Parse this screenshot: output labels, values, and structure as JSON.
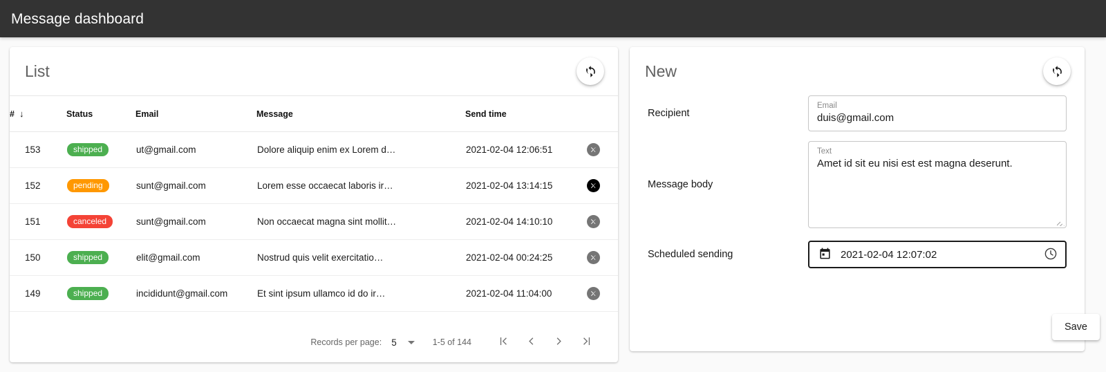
{
  "appbar": {
    "title": "Message dashboard",
    "bg": "#333333",
    "fg": "#ffffff"
  },
  "list_card": {
    "title": "List",
    "refresh_icon": "refresh-icon",
    "columns": [
      {
        "key": "num",
        "label": "#",
        "sort": "↓"
      },
      {
        "key": "status",
        "label": "Status"
      },
      {
        "key": "email",
        "label": "Email"
      },
      {
        "key": "msg",
        "label": "Message"
      },
      {
        "key": "time",
        "label": "Send time"
      }
    ],
    "rows": [
      {
        "num": "153",
        "status": "shipped",
        "status_class": "shipped",
        "email": "ut@gmail.com",
        "msg": "Dolore aliquip enim ex Lorem d…",
        "time": "2021-02-04 12:06:51",
        "delete_hover": false
      },
      {
        "num": "152",
        "status": "pending",
        "status_class": "pending",
        "email": "sunt@gmail.com",
        "msg": "Lorem esse occaecat laboris ir…",
        "time": "2021-02-04 13:14:15",
        "delete_hover": true
      },
      {
        "num": "151",
        "status": "canceled",
        "status_class": "canceled",
        "email": "sunt@gmail.com",
        "msg": "Non occaecat magna sint mollit…",
        "time": "2021-02-04 14:10:10",
        "delete_hover": false
      },
      {
        "num": "150",
        "status": "shipped",
        "status_class": "shipped",
        "email": "elit@gmail.com",
        "msg": "Nostrud quis velit exercitatio…",
        "time": "2021-02-04 00:24:25",
        "delete_hover": false
      },
      {
        "num": "149",
        "status": "shipped",
        "status_class": "shipped",
        "email": "incididunt@gmail.com",
        "msg": "Et sint ipsum ullamco id do ir…",
        "time": "2021-02-04 11:04:00",
        "delete_hover": false
      }
    ],
    "status_colors": {
      "shipped": "#4caf50",
      "pending": "#ff9800",
      "canceled": "#f44336"
    },
    "paginator": {
      "label": "Records per page:",
      "page_size": "5",
      "range": "1-5 of 144",
      "first_icon": "first-page-icon",
      "prev_icon": "previous-page-icon",
      "next_icon": "next-page-icon",
      "last_icon": "last-page-icon"
    }
  },
  "new_card": {
    "title": "New",
    "refresh_icon": "refresh-icon",
    "recipient": {
      "row_label": "Recipient",
      "field_label": "Email",
      "value": "duis@gmail.com",
      "placeholder": "Email"
    },
    "message_body": {
      "row_label": "Message body",
      "field_label": "Text",
      "value": "Amet id sit eu nisi est est magna deserunt.",
      "placeholder": "Text"
    },
    "scheduled": {
      "row_label": "Scheduled sending",
      "value": "2021-02-04 12:07:02",
      "calendar_icon": "calendar-icon",
      "clock_icon": "clock-icon",
      "focused": true
    },
    "save_label": "Save"
  }
}
